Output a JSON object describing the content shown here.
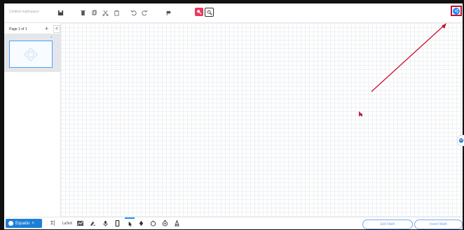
{
  "topbar": {
    "title": "Untitled mathspace"
  },
  "sidebar": {
    "page_label": "Page 1 of 1",
    "add_page": "+",
    "collapse": "<",
    "thumbnail_number": "1"
  },
  "bottombar": {
    "equatio_label": "Equatio",
    "sum_label": "Σ[",
    "latex_label": "LaTeX",
    "edit_math_label": "Edit Math",
    "insert_math_label": "Insert Math"
  },
  "colors": {
    "accent": "#1e90ff",
    "brand": "#1e7fd6",
    "highlight": "#c8102e",
    "pink": "#e8395f"
  },
  "icons": [
    "save-icon",
    "delete-icon",
    "copy-icon",
    "cut-icon",
    "paste-icon",
    "undo-icon",
    "redo-icon",
    "flag-icon",
    "pink-tool-icon",
    "outline-tool-icon",
    "share-icon",
    "equation-icon",
    "graph-icon",
    "handwriting-icon",
    "microphone-icon",
    "phone-icon",
    "pointer-icon",
    "pen-icon",
    "shape-icon",
    "spinner-icon",
    "protractor-icon"
  ]
}
